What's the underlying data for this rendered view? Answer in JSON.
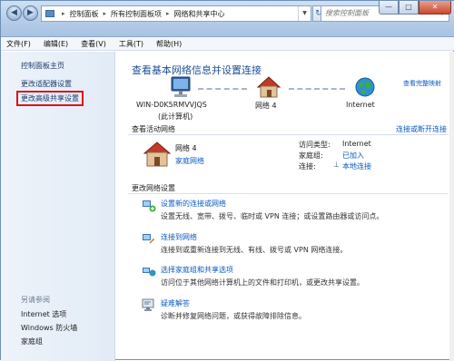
{
  "window": {
    "breadcrumb": [
      "控制面板",
      "所有控制面板项",
      "网络和共享中心"
    ],
    "search_placeholder": "搜索控制面板",
    "controls": {
      "minimize": "—",
      "maximize": "□",
      "close": "✕"
    }
  },
  "menubar": {
    "items": [
      "文件(F)",
      "编辑(E)",
      "查看(V)",
      "工具(T)",
      "帮助(H)"
    ]
  },
  "leftpane": {
    "items": [
      "控制面板主页",
      "更改适配器设置",
      "更改高级共享设置"
    ],
    "see_also_title": "另请参阅",
    "see_also": [
      "Internet 选项",
      "Windows 防火墙",
      "家庭组"
    ]
  },
  "main": {
    "heading": "查看基本网络信息并设置连接",
    "full_map_link": "查看完整映射",
    "map": {
      "computer": "WIN-D0K5RMVVJQS",
      "computer_sub": "(此计算机)",
      "network": "网络 4",
      "internet": "Internet"
    },
    "active_title": "查看活动网络",
    "connect_link": "连接或断开连接",
    "active": {
      "name": "网络 4",
      "type": "家庭网络",
      "access_label": "访问类型:",
      "access_value": "Internet",
      "homegroup_label": "家庭组:",
      "homegroup_value": "已加入",
      "connection_label": "连接:",
      "connection_value": "本地连接"
    },
    "change_title": "更改网络设置",
    "tasks": [
      {
        "link": "设置新的连接或网络",
        "desc": "设置无线、宽带、拨号、临时或 VPN 连接；或设置路由器或访问点。"
      },
      {
        "link": "连接到网络",
        "desc": "连接到或重新连接到无线、有线、拨号或 VPN 网络连接。"
      },
      {
        "link": "选择家庭组和共享选项",
        "desc": "访问位于其他网络计算机上的文件和打印机，或更改共享设置。"
      },
      {
        "link": "疑难解答",
        "desc": "诊断并修复网络问题，或获得故障排除信息。"
      }
    ]
  },
  "colors": {
    "accent": "#1e4f97",
    "link": "#0a5ac2",
    "highlight_box": "#d9141c"
  }
}
